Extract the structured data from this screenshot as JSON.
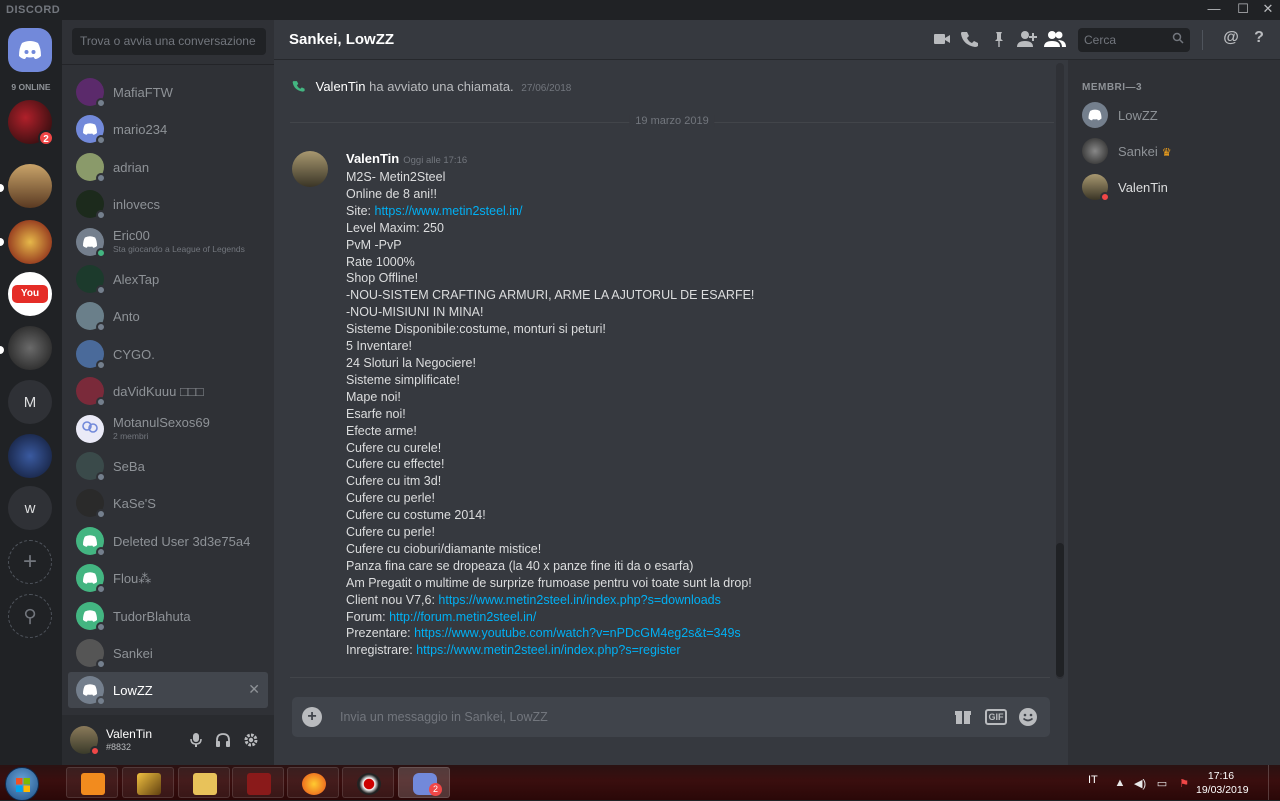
{
  "window": {
    "brand": "DISCORD",
    "minimize": "—",
    "maximize": "☐",
    "close": "✕"
  },
  "guilds": {
    "online_count": "9 ONLINE",
    "badge": "2",
    "letters": [
      "M",
      "w"
    ],
    "add": "+",
    "discover": "⚲"
  },
  "dm_search_placeholder": "Trova o avvia una conversazione",
  "dms": [
    {
      "name": "MafiaFTW",
      "status": "offline",
      "avatar_color": "#5b2a6b"
    },
    {
      "name": "mario234",
      "status": "offline",
      "avatar_color": "#7289da"
    },
    {
      "name": "adrian",
      "status": "offline",
      "avatar_color": "#8a9a6a"
    },
    {
      "name": "inlovecs",
      "status": "offline",
      "avatar_color": "#1c2a1c"
    },
    {
      "name": "Eric00",
      "sub": "Sta giocando a League of Legends",
      "status": "online",
      "avatar_color": "#747f8d"
    },
    {
      "name": "AlexTap",
      "status": "offline",
      "avatar_color": "#1c3a2c"
    },
    {
      "name": "Anto",
      "status": "offline",
      "avatar_color": "#6a7f8a"
    },
    {
      "name": "CYGO.",
      "status": "offline",
      "avatar_color": "#4a6a9a"
    },
    {
      "name": "daVidKuuu □□□",
      "status": "offline",
      "avatar_color": "#7a2a3a"
    },
    {
      "name": "MotanulSexos69",
      "sub": "2 membri",
      "status": "group",
      "avatar_color": "#eaeaf7"
    },
    {
      "name": "SeBa",
      "status": "offline",
      "avatar_color": "#3a4a4a"
    },
    {
      "name": "KaSe'S",
      "status": "offline",
      "avatar_color": "#2a2a2a"
    },
    {
      "name": "Deleted User 3d3e75a4",
      "status": "offline",
      "avatar_color": "#43b581"
    },
    {
      "name": "Flou⁂",
      "status": "offline",
      "avatar_color": "#43b581"
    },
    {
      "name": "TudorBlahuta",
      "status": "offline",
      "avatar_color": "#43b581"
    },
    {
      "name": "Sankei",
      "status": "offline",
      "avatar_color": "#555"
    },
    {
      "name": "LowZZ",
      "status": "offline",
      "avatar_color": "#747f8d",
      "active": true,
      "close": "✕"
    }
  ],
  "user_panel": {
    "name": "ValenTin",
    "tag": "#8832"
  },
  "header": {
    "title": "Sankei, LowZZ",
    "search_placeholder": "Cerca"
  },
  "system_message": {
    "user": "ValenTin",
    "text": "ha avviato una chiamata.",
    "timestamp": "27/06/2018"
  },
  "date_divider": "19 marzo 2019",
  "message": {
    "author": "ValenTin",
    "timestamp": "Oggi alle 17:16",
    "lines": [
      {
        "text": "M2S- Metin2Steel"
      },
      {
        "text": "Online de 8 ani!!"
      },
      {
        "text": "Site: ",
        "link": "https://www.metin2steel.in/"
      },
      {
        "text": "Level Maxim: 250"
      },
      {
        "text": "PvM -PvP"
      },
      {
        "text": "Rate 1000%"
      },
      {
        "text": "Shop Offline!"
      },
      {
        "text": "-NOU-SISTEM CRAFTING ARMURI, ARME LA AJUTORUL DE ESARFE!"
      },
      {
        "text": "-NOU-MISIUNI IN MINA!"
      },
      {
        "text": "Sisteme Disponibile:costume, monturi si peturi!"
      },
      {
        "text": "5 Inventare!"
      },
      {
        "text": "24 Sloturi la Negociere!"
      },
      {
        "text": "Sisteme simplificate!"
      },
      {
        "text": "Mape noi!"
      },
      {
        "text": "Esarfe noi!"
      },
      {
        "text": "Efecte arme!"
      },
      {
        "text": "Cufere cu curele!"
      },
      {
        "text": "Cufere cu effecte!"
      },
      {
        "text": "Cufere cu itm 3d!"
      },
      {
        "text": "Cufere cu perle!"
      },
      {
        "text": "Cufere cu costume 2014!"
      },
      {
        "text": "Cufere cu perle!"
      },
      {
        "text": "Cufere cu cioburi/diamante mistice!"
      },
      {
        "text": "Panza fina care se dropeaza (la 40 x panze fine iti da o esarfa)"
      },
      {
        "text": "Am Pregatit o multime de surprize frumoase pentru voi toate sunt la drop!"
      },
      {
        "text": "Client nou V7,6: ",
        "link": "https://www.metin2steel.in/index.php?s=downloads"
      },
      {
        "text": "Forum: ",
        "link": "http://forum.metin2steel.in/"
      },
      {
        "text": "Prezentare: ",
        "link": "https://www.youtube.com/watch?v=nPDcGM4eg2s&t=349s"
      },
      {
        "text": "Inregistrare: ",
        "link": "https://www.metin2steel.in/index.php?s=register"
      }
    ]
  },
  "composer_placeholder": "Invia un messaggio in Sankei, LowZZ",
  "composer": {
    "attach": "+",
    "gif": "GIF"
  },
  "members": {
    "title": "MEMBRI—3",
    "list": [
      {
        "name": "LowZZ",
        "status": "offline"
      },
      {
        "name": "Sankei",
        "status": "offline",
        "owner": true
      },
      {
        "name": "ValenTin",
        "status": "dnd"
      }
    ]
  },
  "taskbar": {
    "language": "IT",
    "time": "17:16",
    "date": "19/03/2019",
    "discord_badge": "2"
  },
  "colors": {
    "blurple": "#7289da",
    "online": "#43b581",
    "dnd": "#f04747",
    "link": "#00b0f4"
  }
}
